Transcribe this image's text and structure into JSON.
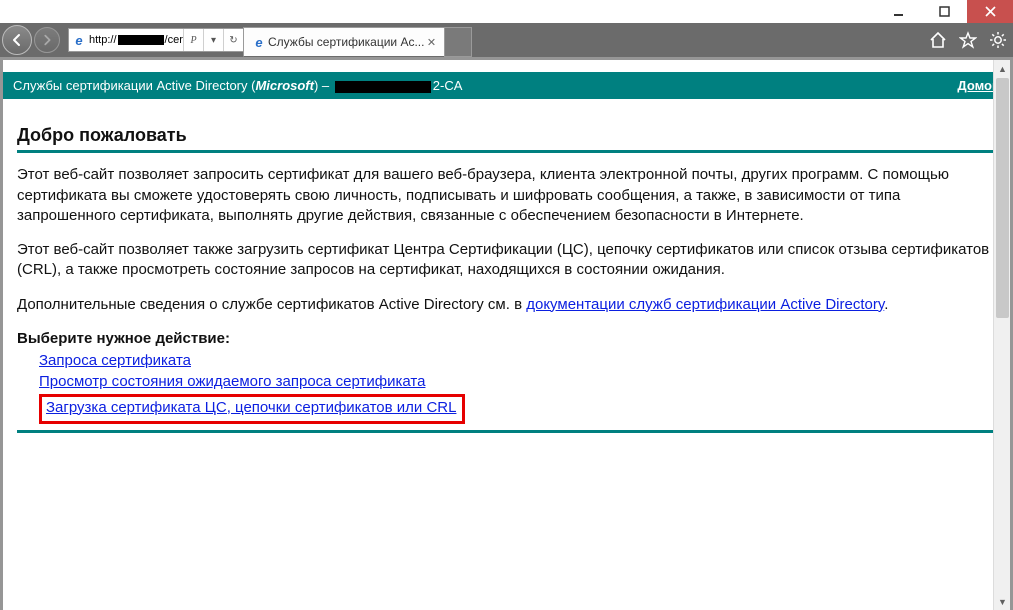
{
  "window": {
    "address_prefix": "http://",
    "address_suffix": "/certsr",
    "tab_title": "Службы сертификации Ac...",
    "addr_search_letter": "P",
    "refresh_label": "↻"
  },
  "banner": {
    "prefix": "Службы сертификации Active Directory (",
    "company": "Microsoft",
    "mid": ")   –   ",
    "suffix": "2-CA",
    "home": "Домой"
  },
  "page": {
    "welcome": "Добро пожаловать",
    "p1": "Этот веб-сайт позволяет запросить сертификат для вашего веб-браузера, клиента электронной почты, других программ. С помощью сертификата вы сможете удостоверять свою личность, подписывать и шифровать сообщения, а также, в зависимости от типа запрошенного сертификата, выполнять другие действия, связанные с обеспечением безопасности в Интернете.",
    "p2": "Этот веб-сайт позволяет также загрузить сертификат Центра Сертификации (ЦС), цепочку сертификатов или список отзыва сертификатов (CRL), а также просмотреть состояние запросов на сертификат, находящихся в состоянии ожидания.",
    "p3_prefix": "Дополнительные сведения о службе сертификатов Active Directory см. в ",
    "p3_link": "документации служб сертификации Active Directory",
    "p3_suffix": ".",
    "choose": "Выберите нужное действие:",
    "a1": "Запроса сертификата",
    "a2": "Просмотр состояния ожидаемого запроса сертификата",
    "a3": "Загрузка сертификата ЦС, цепочки сертификатов или CRL"
  }
}
